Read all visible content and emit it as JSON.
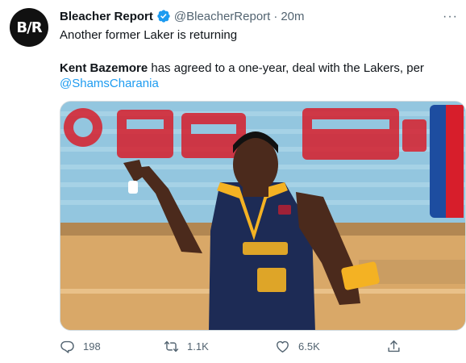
{
  "tweet": {
    "avatar_text": "B/R",
    "author_name": "Bleacher Report",
    "handle": "@BleacherReport",
    "separator": "·",
    "timestamp": "20m",
    "headline": "Another former Laker is returning",
    "body_bold": "Kent Bazemore",
    "body_rest": " has agreed to a one-year, deal with the Lakers, per",
    "mention": "@ShamsCharania",
    "more_menu": "···"
  },
  "actions": {
    "replies": "198",
    "retweets": "1.1K",
    "likes": "6.5K"
  },
  "icons": {
    "verified": "verified-badge-icon",
    "reply": "reply-icon",
    "retweet": "retweet-icon",
    "like": "heart-icon",
    "share": "share-icon"
  },
  "colors": {
    "link": "#1d9bf0",
    "muted": "#536471",
    "text": "#0f1419",
    "court_floor": "#d9a868",
    "jersey_navy": "#1d2b55",
    "jersey_gold": "#f4b223",
    "statefarm_red": "#d71e2b"
  }
}
